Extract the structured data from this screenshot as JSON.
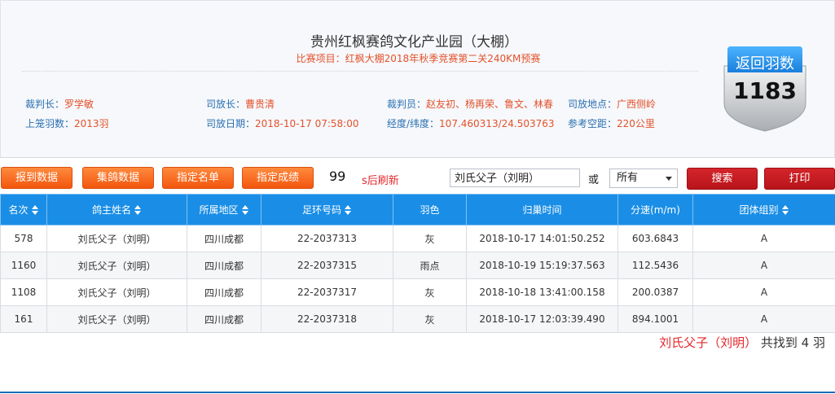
{
  "header": {
    "title": "贵州红枫赛鸽文化产业园（大棚）",
    "subtitle": "比赛项目：红枫大棚2018年秋季竞赛第二关240KM预赛",
    "info": [
      {
        "key": "裁判长：",
        "value": "罗学敏"
      },
      {
        "key": "司放长：",
        "value": "曹贵清"
      },
      {
        "key": "裁判员：",
        "value": "赵友初、杨再荣、鲁文、林春"
      },
      {
        "key": "司放地点：",
        "value": "广西侧岭"
      },
      {
        "key": "上笼羽数：",
        "value": "2013羽"
      },
      {
        "key": "司放日期：",
        "value": "2018-10-17 07:58:00"
      },
      {
        "key": "经度/纬度：",
        "value": "107.460313/24.503763"
      },
      {
        "key": "参考空距：",
        "value": "220公里"
      }
    ],
    "badge": {
      "label": "返回羽数",
      "count": "1183"
    }
  },
  "toolbar": {
    "buttons": [
      "报到数据",
      "集鸽数据",
      "指定名单",
      "指定成绩"
    ],
    "countdown": "99",
    "countdown_text": "s后刷新",
    "search_value": "刘氏父子（刘明）",
    "or_text": "或",
    "select_value": "所有",
    "search_label": "搜索",
    "print_label": "打印"
  },
  "table": {
    "columns": [
      "名次",
      "鸽主姓名",
      "所属地区",
      "足环号码",
      "羽色",
      "归巢时间",
      "分速(m/m)",
      "团体组别"
    ],
    "rows": [
      [
        "578",
        "刘氏父子（刘明）",
        "四川成都",
        "22-2037313",
        "灰",
        "2018-10-17 14:01:50.252",
        "603.6843",
        "A"
      ],
      [
        "1160",
        "刘氏父子（刘明）",
        "四川成都",
        "22-2037315",
        "雨点",
        "2018-10-19 15:19:37.563",
        "112.5436",
        "A"
      ],
      [
        "1108",
        "刘氏父子（刘明）",
        "四川成都",
        "22-2037317",
        "灰",
        "2018-10-18 13:41:00.158",
        "200.0387",
        "A"
      ],
      [
        "161",
        "刘氏父子（刘明）",
        "四川成都",
        "22-2037318",
        "灰",
        "2018-10-17 12:03:39.490",
        "894.1001",
        "A"
      ]
    ]
  },
  "summary": {
    "name": "刘氏父子（刘明）",
    "text": " 共找到 4 羽"
  },
  "colors": {
    "accent": "#1a8ee6",
    "orange": "#f2560e",
    "red": "#c31c22",
    "highlight": "#e4512b"
  }
}
